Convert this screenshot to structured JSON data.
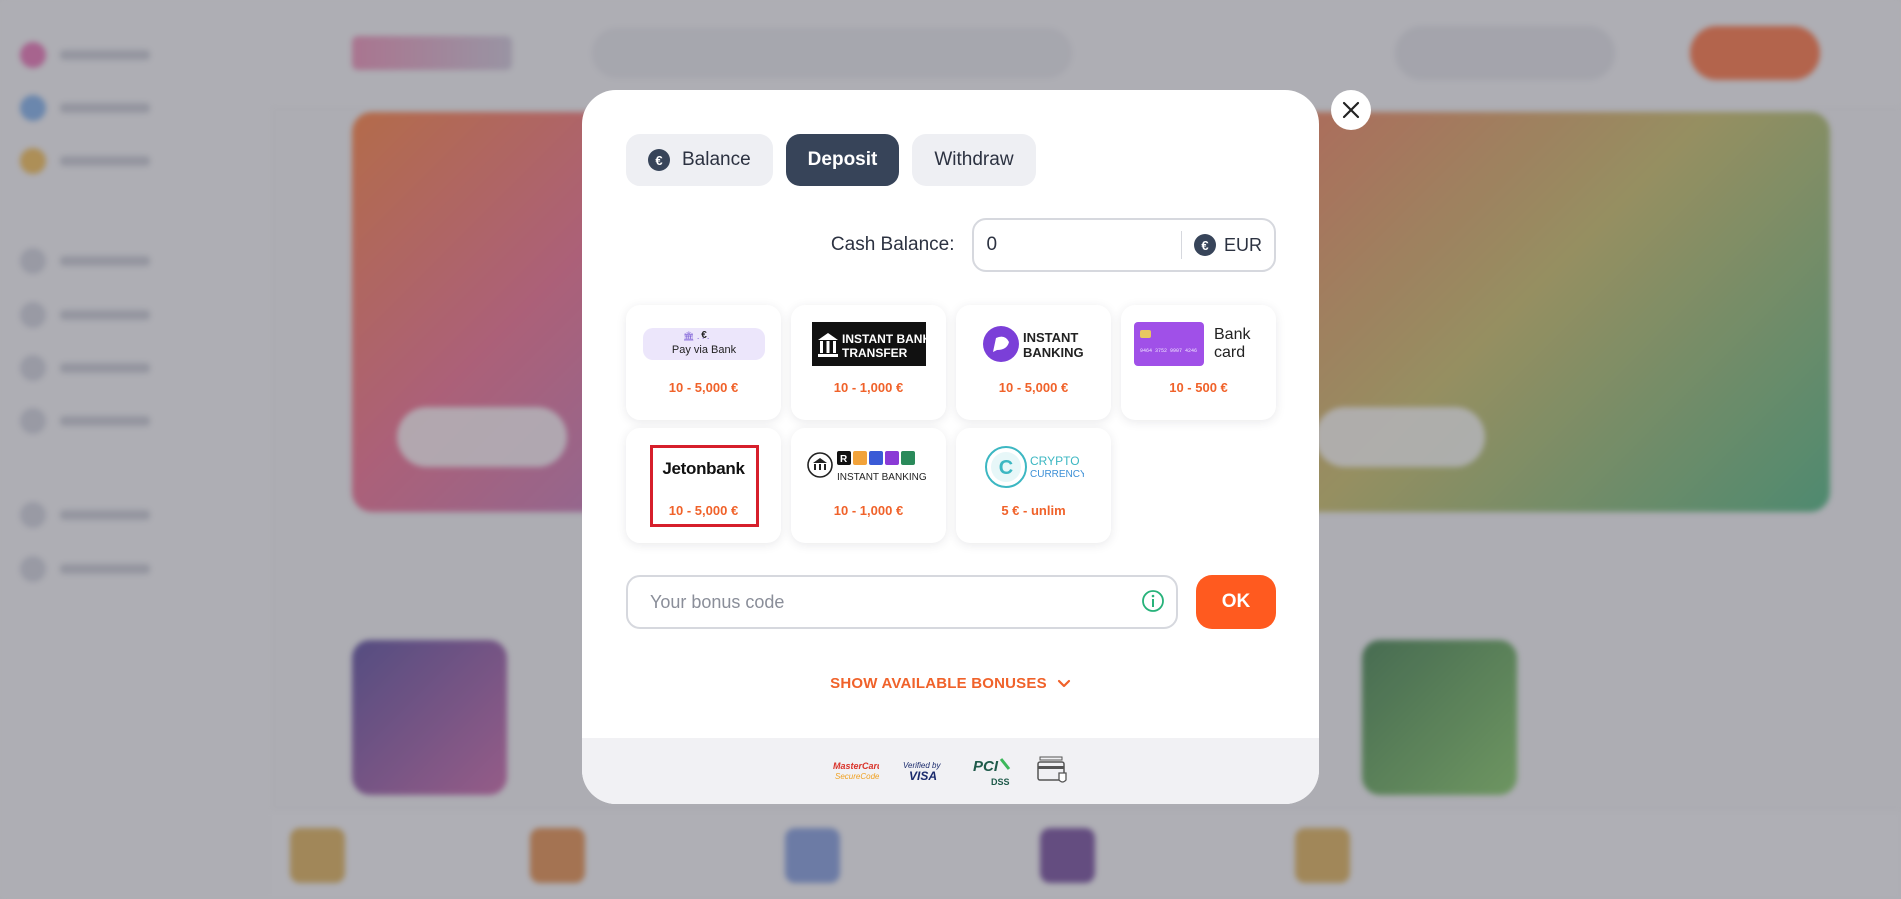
{
  "modal": {
    "tabs": [
      {
        "label": "Balance"
      },
      {
        "label": "Deposit"
      },
      {
        "label": "Withdraw"
      }
    ],
    "active_tab": "Deposit",
    "cash_balance": {
      "label": "Cash Balance:",
      "value": "0",
      "currency": "EUR",
      "currency_symbol": "€"
    },
    "payment_methods": [
      {
        "name": "Pay via Bank",
        "range": "10 - 5,000 €"
      },
      {
        "name": "INSTANT BANK TRANSFER",
        "range": "10 - 1,000 €"
      },
      {
        "name": "INSTANT BANKING",
        "range": "10 - 5,000 €"
      },
      {
        "name": "Bank card",
        "range": "10 - 500 €"
      },
      {
        "name": "Jetonbank",
        "range": "10 - 5,000 €",
        "selected": true
      },
      {
        "name": "INSTANT BANKING",
        "range": "10 - 1,000 €"
      },
      {
        "name": "CRYPTO CURRENCY",
        "range": "5 € - unlim"
      }
    ],
    "logo_text": {
      "pay_via_bank": "Pay via Bank",
      "instant_bank_line1": "INSTANT BANK",
      "instant_bank_line2": "TRANSFER",
      "instant_banking_line1": "INSTANT",
      "instant_banking_line2": "BANKING",
      "bank_card_line1": "Bank",
      "bank_card_line2": "card",
      "card_number": "9464 3752 9907 4246",
      "jetonbank": "Jetonbank",
      "instant_banking_2": "INSTANT BANKING",
      "crypto_line1": "CRYPTO",
      "crypto_line2": "CURRENCY"
    },
    "bonus": {
      "placeholder": "Your bonus code",
      "ok_label": "OK"
    },
    "show_bonuses_label": "SHOW AVAILABLE BONUSES",
    "footer_certs": [
      {
        "name": "MasterCard SecureCode",
        "line1": "MasterCard",
        "line2": "SecureCode"
      },
      {
        "name": "Verified by VISA",
        "line1": "Verified by",
        "line2": "VISA"
      },
      {
        "name": "PCI DSS",
        "line1": "PCI",
        "line2": "DSS"
      },
      {
        "name": "Secure payment card icon"
      }
    ]
  },
  "colors": {
    "accent": "#ff5a1f",
    "accent_text": "#f0622a",
    "active_tab": "#374459",
    "selected_outline": "#d61f2b"
  }
}
